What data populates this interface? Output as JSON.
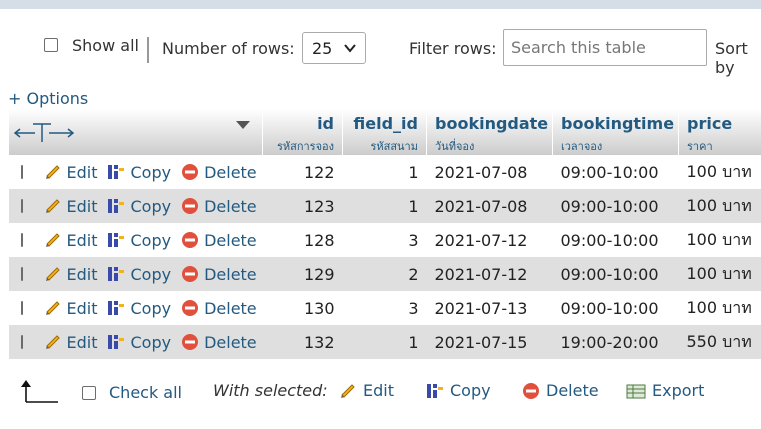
{
  "nav": {
    "show_all_label": "Show all",
    "rows_label": "Number of rows:",
    "rows_value": "25",
    "filter_label": "Filter rows:",
    "search_placeholder": "Search this table",
    "sort_label": "Sort by"
  },
  "options_label": "+ Options",
  "columns": [
    {
      "name": "id",
      "comment": "รหัสการจอง"
    },
    {
      "name": "field_id",
      "comment": "รหัสสนาม"
    },
    {
      "name": "bookingdate",
      "comment": "วันที่จอง"
    },
    {
      "name": "bookingtime",
      "comment": "เวลาจอง"
    },
    {
      "name": "price",
      "comment": "ราคา"
    }
  ],
  "row_actions": {
    "edit": "Edit",
    "copy": "Copy",
    "delete": "Delete"
  },
  "rows": [
    {
      "id": "122",
      "field_id": "1",
      "bookingdate": "2021-07-08",
      "bookingtime": "09:00-10:00",
      "price": "100 บาท"
    },
    {
      "id": "123",
      "field_id": "1",
      "bookingdate": "2021-07-08",
      "bookingtime": "09:00-10:00",
      "price": "100 บาท"
    },
    {
      "id": "128",
      "field_id": "3",
      "bookingdate": "2021-07-12",
      "bookingtime": "09:00-10:00",
      "price": "100 บาท"
    },
    {
      "id": "129",
      "field_id": "2",
      "bookingdate": "2021-07-12",
      "bookingtime": "09:00-10:00",
      "price": "100 บาท"
    },
    {
      "id": "130",
      "field_id": "3",
      "bookingdate": "2021-07-13",
      "bookingtime": "09:00-10:00",
      "price": "100 บาท"
    },
    {
      "id": "132",
      "field_id": "1",
      "bookingdate": "2021-07-15",
      "bookingtime": "19:00-20:00",
      "price": "550 บาท"
    }
  ],
  "bottom": {
    "check_all": "Check all",
    "with_selected": "With selected:",
    "edit": "Edit",
    "copy": "Copy",
    "delete": "Delete",
    "export": "Export"
  },
  "colors": {
    "link": "#235a81",
    "row_alt": "#dfdfdf",
    "delete_icon": "#e0503c"
  }
}
